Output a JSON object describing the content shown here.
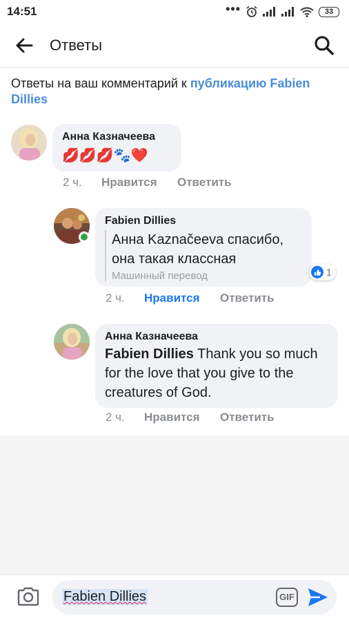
{
  "status_bar": {
    "time": "14:51",
    "dots": "•••",
    "battery": "33",
    "icons": [
      "alarm-icon",
      "signal-icon",
      "signal-icon",
      "wifi-icon",
      "battery-icon"
    ]
  },
  "header": {
    "title": "Ответы",
    "back_icon": "arrow-left-icon",
    "search_icon": "search-icon"
  },
  "intro": {
    "text": "Ответы на ваш комментарий к ",
    "link": "публикацию Fabien Dillies"
  },
  "comments": [
    {
      "author": "Анна Казначеева",
      "text": "💋💋💋🐾❤️",
      "time": "2 ч.",
      "like_label": "Нравится",
      "reply_label": "Ответить"
    },
    {
      "author": "Fabien Dillies",
      "text": "Анна Kaznačeeva спасибо, она такая классная",
      "translation_note": "Машинный перевод",
      "reaction_count": "1",
      "time": "2 ч.",
      "like_label": "Нравится",
      "reply_label": "Ответить",
      "liked": true
    },
    {
      "author": "Анна Казначеева",
      "mention": "Fabien Dillies",
      "text": " Thank you so much for the love that you give to the creatures of God.",
      "time": "2 ч.",
      "like_label": "Нравится",
      "reply_label": "Ответить"
    }
  ],
  "composer": {
    "value": "Fabien Dillies",
    "gif_label": "GIF"
  },
  "colors": {
    "link": "#4b8cd8",
    "like_active": "#1877f2",
    "bubble": "#f0f2f5",
    "online": "#31a24c",
    "send": "#1877f2"
  }
}
